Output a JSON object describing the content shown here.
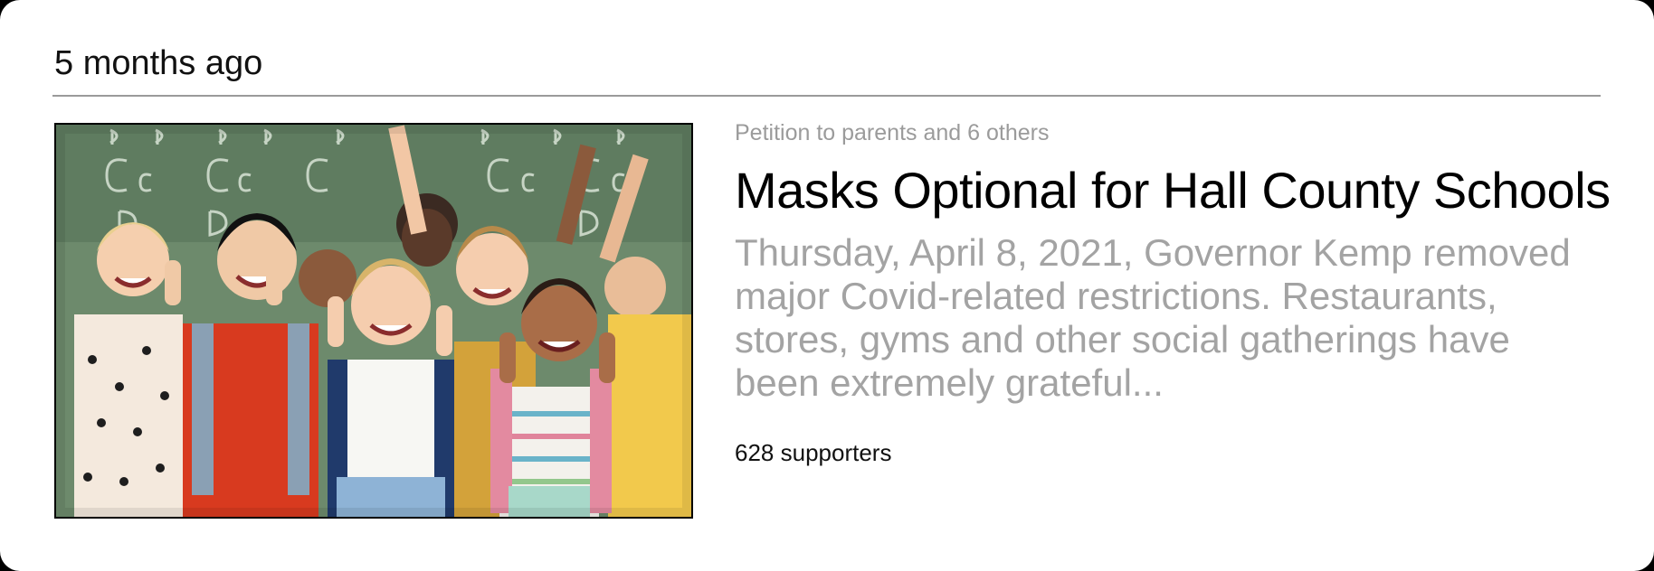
{
  "timestamp": "5 months ago",
  "petition": {
    "recipient": "Petition to parents and 6 others",
    "title": "Masks Optional for Hall County Schools",
    "description": "Thursday, April 8, 2021, Governor Kemp removed major Covid-related restrictions. Restaurants, stores, gyms and other social gatherings have been extremely grateful...",
    "supporters": "628 supporters",
    "image_subject": "children giving thumbs up in front of a chalkboard"
  },
  "colors": {
    "divider": "#9a9a9a",
    "muted_text": "#a3a3a3",
    "chalkboard": "#6f8a6e"
  }
}
